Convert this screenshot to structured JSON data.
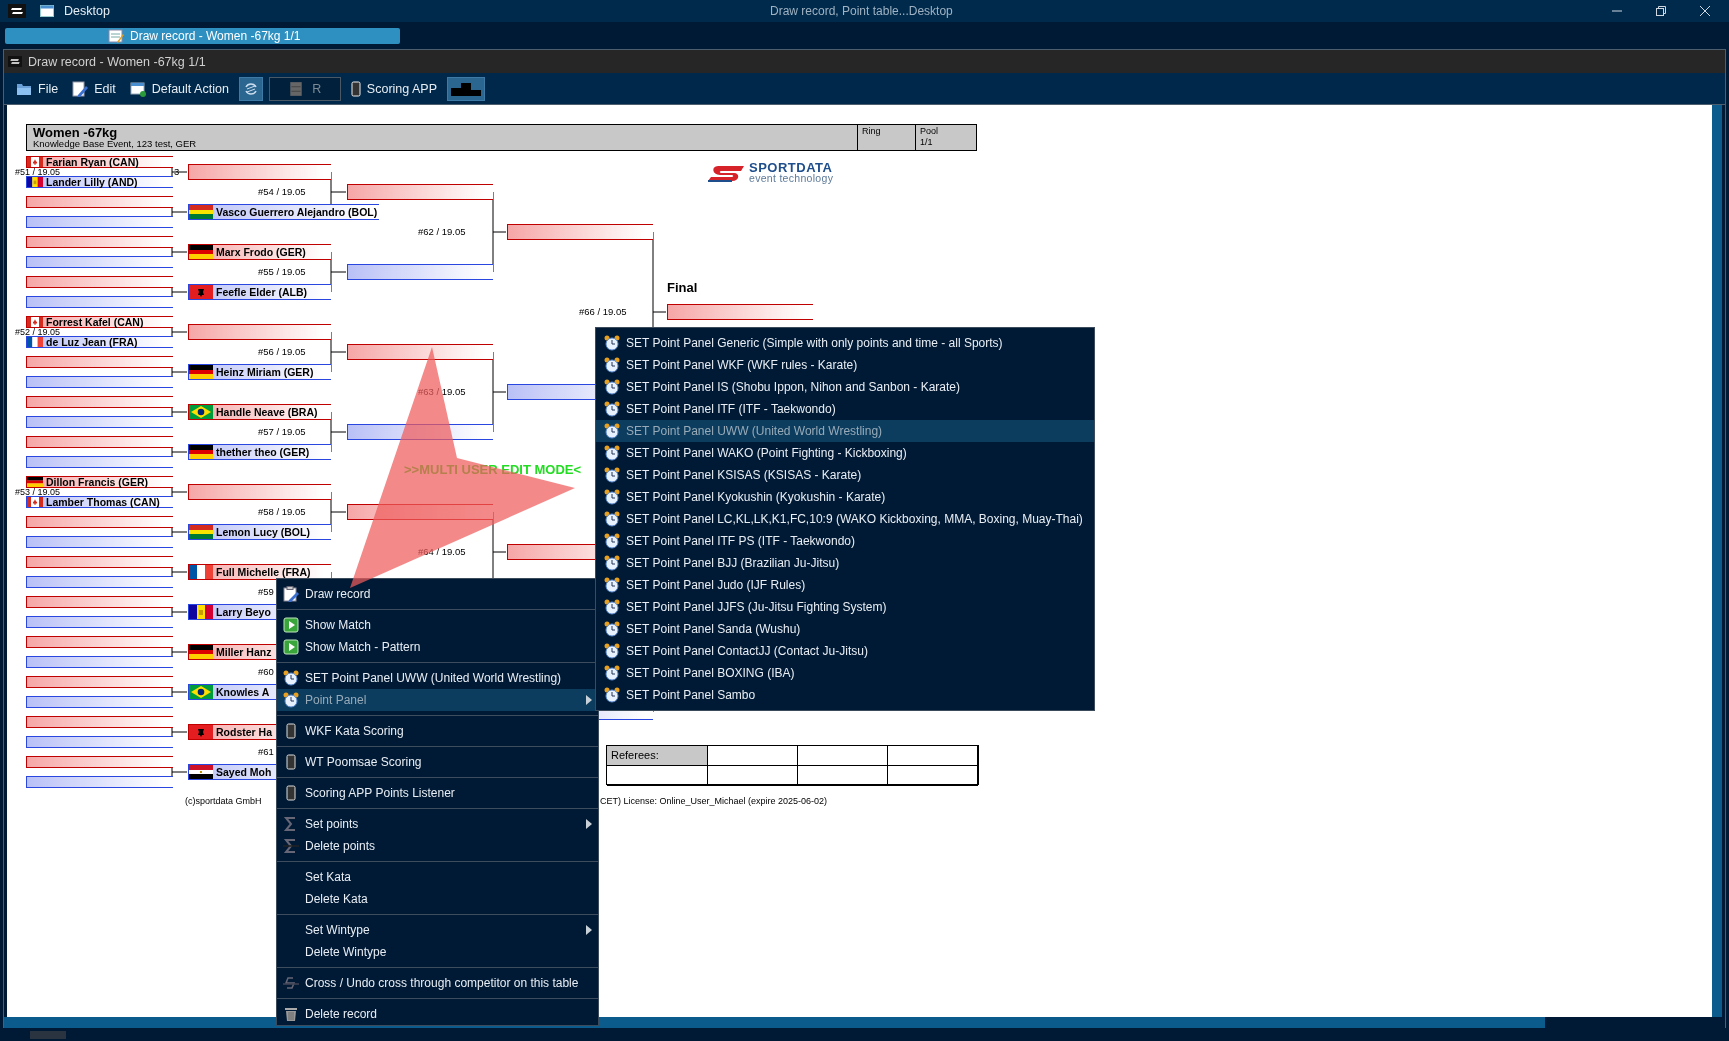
{
  "title_bar": {
    "app_title": "Desktop",
    "center_title": "Draw record, Point table...Desktop"
  },
  "taskbar": {
    "tabs": [
      {
        "label": "Draw record - Women -67kg 1/1",
        "selected": true
      }
    ]
  },
  "window": {
    "title": "Draw record - Women -67kg 1/1"
  },
  "toolbar": {
    "items": [
      {
        "kind": "menu",
        "label": "File"
      },
      {
        "kind": "menu",
        "label": "Edit"
      },
      {
        "kind": "menu",
        "label": "Default Action"
      },
      {
        "kind": "toggle",
        "on": true
      },
      {
        "kind": "field",
        "value": "R",
        "disabled": true
      },
      {
        "kind": "menu",
        "label": "Scoring APP"
      },
      {
        "kind": "toggle",
        "on": true
      }
    ]
  },
  "bracket": {
    "header": {
      "title": "Women -67kg",
      "subtitle": "Knowledge Base Event, 123 test, GER",
      "ring_label": "Ring",
      "pool_label": "Pool",
      "pool_value": "1/1"
    },
    "logo": {
      "name": "SPORTDATA",
      "tagline": "event technology"
    },
    "second_round": [
      {
        "label": "#54 / 19.05",
        "red": {
          "feeder": {
            "label": "#51 / 19.05",
            "tail": "3",
            "red": {
              "name": "Farian Ryan (CAN)"
            },
            "blue": {
              "name": "Lander Lilly (AND)"
            }
          }
        },
        "blue": {
          "name": "Vasco Guerrero Alejandro (BOL)"
        }
      },
      {
        "label": "#55 / 19.05",
        "red": {
          "name": "Marx Frodo (GER)"
        },
        "blue": {
          "name": "Feefle Elder (ALB)"
        }
      },
      {
        "label": "#56 / 19.05",
        "red": {
          "feeder": {
            "label": "#52 / 19.05",
            "red": {
              "name": "Forrest Kafel (CAN)"
            },
            "blue": {
              "name": "de Luz Jean (FRA)"
            }
          }
        },
        "blue": {
          "name": "Heinz Miriam (GER)"
        }
      },
      {
        "label": "#57 / 19.05",
        "red": {
          "name": "Handle Neave (BRA)"
        },
        "blue": {
          "name": "thether theo (GER)"
        }
      },
      {
        "label": "#58 / 19.05",
        "red": {
          "feeder": {
            "label": "#53 / 19.05",
            "red": {
              "name": "Dillon Francis (GER)"
            },
            "blue": {
              "name": "Lamber Thomas (CAN)"
            }
          }
        },
        "blue": {
          "name": "Lemon Lucy (BOL)"
        }
      },
      {
        "label": "#59",
        "red": {
          "name": "Full Michelle (FRA)"
        },
        "blue": {
          "name": "Larry Beyo"
        }
      },
      {
        "label": "#60",
        "red": {
          "name": "Miller Hanz"
        },
        "blue": {
          "name": "Knowles A"
        }
      },
      {
        "label": "#61",
        "red": {
          "name": "Rodster Ha"
        },
        "blue": {
          "name": "Sayed Moh"
        }
      }
    ],
    "quarterfinals": [
      {
        "label": "#62 / 19.05"
      },
      {
        "label": "#63 / 19.05"
      },
      {
        "label": "#64 / 19.05"
      }
    ],
    "semifinals": [
      {
        "label": "#66 / 19.05"
      }
    ],
    "final": {
      "title": "Final"
    },
    "mode_banner": ">>MULTI USER EDIT MODE<",
    "referees": {
      "label": "Referees:"
    },
    "footer": {
      "copyright": "(c)sportdata GmbH",
      "license": "CET) License: Online_User_Michael (expire 2025-06-02)"
    }
  },
  "context_menu": {
    "items": [
      {
        "kind": "item",
        "label": "Draw record",
        "has_submenu": false,
        "selected": false
      },
      {
        "kind": "separator"
      },
      {
        "kind": "item",
        "label": "Show Match",
        "has_submenu": false,
        "selected": false
      },
      {
        "kind": "item",
        "label": "Show Match - Pattern",
        "has_submenu": false,
        "selected": false
      },
      {
        "kind": "separator"
      },
      {
        "kind": "item",
        "label": "SET Point Panel UWW (United World Wrestling)",
        "has_submenu": false,
        "selected": false
      },
      {
        "kind": "item",
        "label": "Point Panel",
        "has_submenu": true,
        "selected": true
      },
      {
        "kind": "separator"
      },
      {
        "kind": "item",
        "label": "WKF Kata Scoring",
        "has_submenu": false,
        "selected": false
      },
      {
        "kind": "separator"
      },
      {
        "kind": "item",
        "label": "WT Poomsae Scoring",
        "has_submenu": false,
        "selected": false
      },
      {
        "kind": "separator"
      },
      {
        "kind": "item",
        "label": "Scoring APP Points Listener",
        "has_submenu": false,
        "selected": false
      },
      {
        "kind": "separator"
      },
      {
        "kind": "item",
        "label": "Set points",
        "has_submenu": true,
        "selected": false
      },
      {
        "kind": "item",
        "label": "Delete points",
        "has_submenu": false,
        "selected": false
      },
      {
        "kind": "separator"
      },
      {
        "kind": "item",
        "label": "Set Kata",
        "has_submenu": false,
        "selected": false
      },
      {
        "kind": "item",
        "label": "Delete Kata",
        "has_submenu": false,
        "selected": false
      },
      {
        "kind": "separator"
      },
      {
        "kind": "item",
        "label": "Set Wintype",
        "has_submenu": true,
        "selected": false
      },
      {
        "kind": "item",
        "label": "Delete Wintype",
        "has_submenu": false,
        "selected": false
      },
      {
        "kind": "separator"
      },
      {
        "kind": "item",
        "label": "Cross / Undo cross through competitor on this table",
        "has_submenu": false,
        "selected": false
      },
      {
        "kind": "separator"
      },
      {
        "kind": "item",
        "label": "Delete record",
        "has_submenu": false,
        "selected": false
      }
    ]
  },
  "submenu": {
    "items": [
      {
        "label": "SET Point Panel Generic (Simple with only points and time - all Sports)",
        "selected": false
      },
      {
        "label": "SET Point Panel WKF (WKF rules - Karate)",
        "selected": false
      },
      {
        "label": "SET Point Panel IS (Shobu Ippon, Nihon and Sanbon - Karate)",
        "selected": false
      },
      {
        "label": "SET Point Panel ITF (ITF - Taekwondo)",
        "selected": false
      },
      {
        "label": "SET Point Panel UWW (United World Wrestling)",
        "selected": true
      },
      {
        "label": "SET Point Panel WAKO (Point Fighting - Kickboxing)",
        "selected": false
      },
      {
        "label": "SET Point Panel KSISAS (KSISAS - Karate)",
        "selected": false
      },
      {
        "label": "SET Point Panel Kyokushin (Kyokushin - Karate)",
        "selected": false
      },
      {
        "label": "SET Point Panel LC,KL,LK,K1,FC,10:9 (WAKO Kickboxing, MMA, Boxing, Muay-Thai)",
        "selected": false
      },
      {
        "label": "SET Point Panel ITF PS (ITF - Taekwondo)",
        "selected": false
      },
      {
        "label": "SET Point Panel BJJ (Brazilian Ju-Jitsu)",
        "selected": false
      },
      {
        "label": "SET Point Panel Judo (IJF Rules)",
        "selected": false
      },
      {
        "label": "SET Point Panel JJFS (Ju-Jitsu Fighting System)",
        "selected": false
      },
      {
        "label": "SET Point Panel Sanda (Wushu)",
        "selected": false
      },
      {
        "label": "SET Point Panel ContactJJ (Contact Ju-Jitsu)",
        "selected": false
      },
      {
        "label": "SET Point Panel BOXING (IBA)",
        "selected": false
      },
      {
        "label": "SET Point Panel Sambo",
        "selected": false
      }
    ]
  }
}
